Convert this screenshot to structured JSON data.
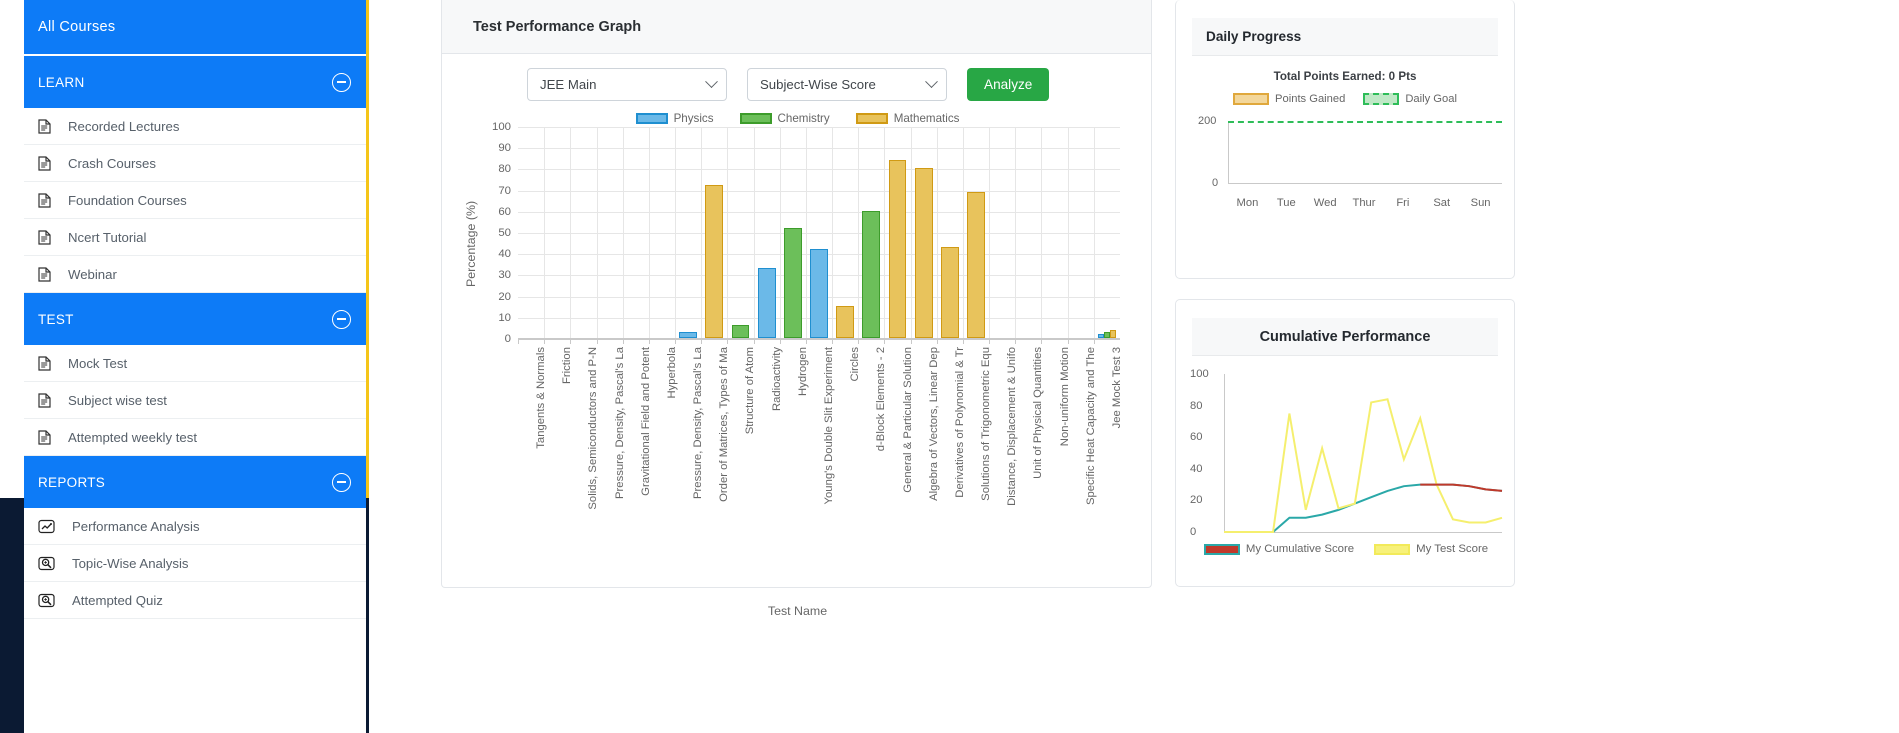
{
  "sidebar": {
    "all_courses_label": "All Courses",
    "sections": [
      {
        "title": "LEARN",
        "items": [
          {
            "label": "Recorded Lectures",
            "icon": "document-icon"
          },
          {
            "label": "Crash Courses",
            "icon": "document-icon"
          },
          {
            "label": "Foundation Courses",
            "icon": "document-icon"
          },
          {
            "label": "Ncert Tutorial",
            "icon": "document-icon"
          },
          {
            "label": "Webinar",
            "icon": "document-icon"
          }
        ]
      },
      {
        "title": "TEST",
        "items": [
          {
            "label": "Mock Test",
            "icon": "document-icon"
          },
          {
            "label": "Subject wise test",
            "icon": "document-icon"
          },
          {
            "label": "Attempted weekly test",
            "icon": "document-icon"
          }
        ]
      },
      {
        "title": "REPORTS",
        "items": [
          {
            "label": "Performance Analysis",
            "icon": "line-chart-icon"
          },
          {
            "label": "Topic-Wise Analysis",
            "icon": "magnifier-icon"
          },
          {
            "label": "Attempted Quiz",
            "icon": "magnifier-icon"
          }
        ]
      }
    ],
    "accent_color": "#f5c518",
    "section_color": "#0d7bf7"
  },
  "main": {
    "title": "Test Performance Graph",
    "exam_select": {
      "value": "JEE Main"
    },
    "metric_select": {
      "value": "Subject-Wise Score"
    },
    "analyze_label": "Analyze",
    "analyze_color": "#28a745"
  },
  "chart_data": [
    {
      "id": "test-performance-graph",
      "type": "bar",
      "title": "Test Performance Graph",
      "xlabel": "Test Name",
      "ylabel": "Percentage (%)",
      "ylim": [
        0,
        100
      ],
      "yticks": [
        0,
        10,
        20,
        30,
        40,
        50,
        60,
        70,
        80,
        90,
        100
      ],
      "grid": true,
      "legend_position": "top",
      "legend": [
        {
          "name": "Physics",
          "color": "#6bb9e8",
          "border": "#1f7fc4"
        },
        {
          "name": "Chemistry",
          "color": "#6cbf5a",
          "border": "#3e9e2c"
        },
        {
          "name": "Mathematics",
          "color": "#e6c濃56",
          "border": "#d19e16"
        }
      ],
      "categories": [
        "Tangents & Normals",
        "Friction",
        "Solids, Semiconductors and P-N",
        "Pressure, Density, Pascal's La",
        "Gravitational Field and Potent",
        "Hyperbola",
        "Pressure, Density, Pascal's La",
        "Order of Matrices, Types of Ma",
        "Structure of Atom",
        "Radioactivity",
        "Hydrogen",
        "Young's Double Slit Experiment",
        "Circles",
        "d-Block Elements - 2",
        "General & Particular Solution",
        "Algebra of Vectors, Linear Dep",
        "Derivatives of Polynomial & Tr",
        "Solutions of Trigonometric Equ",
        "Distance, Displacement & Unifo",
        "Unit of Physical Quantities",
        "Non-uniform Motion",
        "Specific Heat Capacity and The",
        "Jee Mock Test 3"
      ],
      "series": [
        {
          "name": "Physics",
          "values": [
            0,
            0,
            0,
            0,
            0,
            0,
            3,
            0,
            0,
            33,
            0,
            42,
            0,
            0,
            0,
            0,
            0,
            0,
            0,
            0,
            0,
            0,
            2
          ]
        },
        {
          "name": "Chemistry",
          "values": [
            0,
            0,
            0,
            0,
            0,
            0,
            0,
            0,
            6,
            0,
            52,
            0,
            0,
            60,
            0,
            0,
            0,
            0,
            0,
            0,
            0,
            0,
            3
          ]
        },
        {
          "name": "Mathematics",
          "values": [
            0,
            0,
            0,
            0,
            0,
            0,
            0,
            72,
            0,
            0,
            0,
            0,
            15,
            0,
            84,
            80,
            43,
            69,
            0,
            0,
            0,
            0,
            4
          ]
        }
      ]
    },
    {
      "id": "daily-progress",
      "type": "bar",
      "title": "Daily Progress",
      "subtitle": "Total Points Earned: 0 Pts",
      "categories": [
        "Mon",
        "Tue",
        "Wed",
        "Thur",
        "Fri",
        "Sat",
        "Sun"
      ],
      "yticks": [
        0,
        200
      ],
      "ylim": [
        0,
        200
      ],
      "legend_position": "top",
      "legend": [
        {
          "name": "Points Gained",
          "color": "#f3d79b",
          "border": "#e0a83c"
        },
        {
          "name": "Daily Goal",
          "color": "#bfe8c6",
          "border": "#2ebd59"
        }
      ],
      "series": [
        {
          "name": "Points Gained",
          "values": [
            0,
            0,
            0,
            0,
            0,
            0,
            0
          ]
        },
        {
          "name": "Daily Goal",
          "values": [
            200,
            200,
            200,
            200,
            200,
            200,
            200
          ]
        }
      ]
    },
    {
      "id": "cumulative-performance",
      "type": "line",
      "title": "Cumulative Performance",
      "ylim": [
        0,
        100
      ],
      "yticks": [
        0,
        20,
        40,
        60,
        80,
        100
      ],
      "legend_position": "bottom",
      "legend": [
        {
          "name": "My Cumulative Score",
          "color": "#c0392b",
          "border": "#2aa8a8"
        },
        {
          "name": "My Test Score",
          "color": "#f7f17a",
          "border": "#f2ea5a"
        }
      ],
      "series": [
        {
          "name": "My Cumulative Score",
          "color": "#2aa8a8",
          "values": [
            0,
            0,
            0,
            0,
            9,
            9,
            11,
            14,
            18,
            22,
            26,
            29,
            30,
            30,
            30,
            29,
            27,
            26
          ]
        },
        {
          "name": "My Test Score",
          "color": "#f5ef6e",
          "values": [
            0,
            0,
            0,
            0,
            75,
            14,
            53,
            15,
            18,
            82,
            84,
            46,
            72,
            30,
            8,
            6,
            6,
            9
          ]
        }
      ]
    }
  ]
}
